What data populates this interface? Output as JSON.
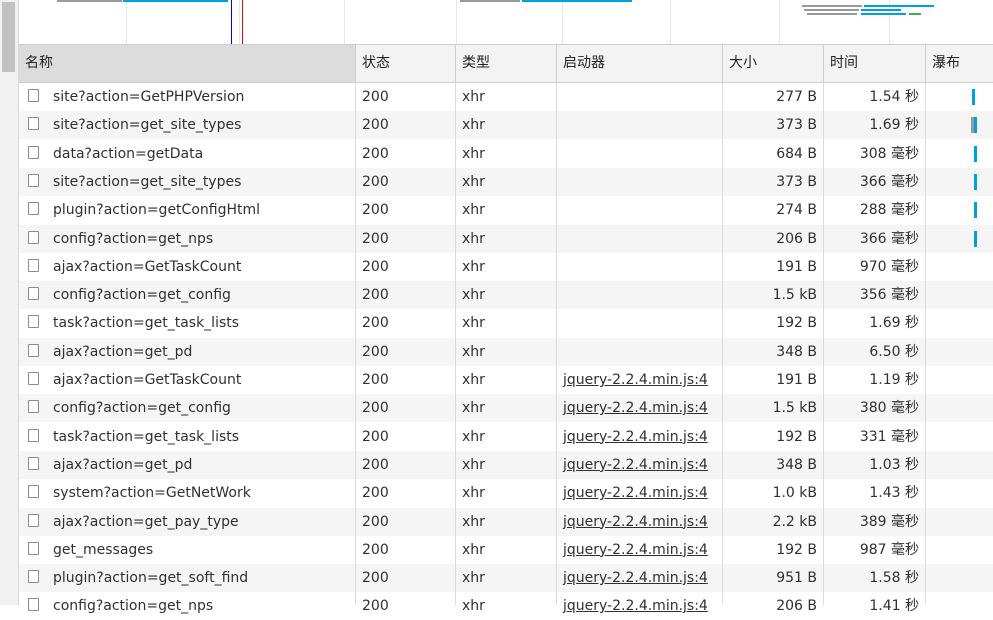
{
  "columns": {
    "name": "名称",
    "status": "状态",
    "type": "类型",
    "initiator": "启动器",
    "size": "大小",
    "time": "时间",
    "waterfall": "瀑布"
  },
  "rows": [
    {
      "name": "site?action=GetPHPVersion",
      "status": "200",
      "type": "xhr",
      "initiator": "",
      "size": "277 B",
      "time": "1.54 秒"
    },
    {
      "name": "site?action=get_site_types",
      "status": "200",
      "type": "xhr",
      "initiator": "",
      "size": "373 B",
      "time": "1.69 秒"
    },
    {
      "name": "data?action=getData",
      "status": "200",
      "type": "xhr",
      "initiator": "",
      "size": "684 B",
      "time": "308 毫秒"
    },
    {
      "name": "site?action=get_site_types",
      "status": "200",
      "type": "xhr",
      "initiator": "",
      "size": "373 B",
      "time": "366 毫秒"
    },
    {
      "name": "plugin?action=getConfigHtml",
      "status": "200",
      "type": "xhr",
      "initiator": "",
      "size": "274 B",
      "time": "288 毫秒"
    },
    {
      "name": "config?action=get_nps",
      "status": "200",
      "type": "xhr",
      "initiator": "",
      "size": "206 B",
      "time": "366 毫秒"
    },
    {
      "name": "ajax?action=GetTaskCount",
      "status": "200",
      "type": "xhr",
      "initiator": "",
      "size": "191 B",
      "time": "970 毫秒"
    },
    {
      "name": "config?action=get_config",
      "status": "200",
      "type": "xhr",
      "initiator": "",
      "size": "1.5 kB",
      "time": "356 毫秒"
    },
    {
      "name": "task?action=get_task_lists",
      "status": "200",
      "type": "xhr",
      "initiator": "",
      "size": "192 B",
      "time": "1.69 秒"
    },
    {
      "name": "ajax?action=get_pd",
      "status": "200",
      "type": "xhr",
      "initiator": "",
      "size": "348 B",
      "time": "6.50 秒"
    },
    {
      "name": "ajax?action=GetTaskCount",
      "status": "200",
      "type": "xhr",
      "initiator": "jquery-2.2.4.min.js:4",
      "size": "191 B",
      "time": "1.19 秒"
    },
    {
      "name": "config?action=get_config",
      "status": "200",
      "type": "xhr",
      "initiator": "jquery-2.2.4.min.js:4",
      "size": "1.5 kB",
      "time": "380 毫秒"
    },
    {
      "name": "task?action=get_task_lists",
      "status": "200",
      "type": "xhr",
      "initiator": "jquery-2.2.4.min.js:4",
      "size": "192 B",
      "time": "331 毫秒"
    },
    {
      "name": "ajax?action=get_pd",
      "status": "200",
      "type": "xhr",
      "initiator": "jquery-2.2.4.min.js:4",
      "size": "348 B",
      "time": "1.03 秒"
    },
    {
      "name": "system?action=GetNetWork",
      "status": "200",
      "type": "xhr",
      "initiator": "jquery-2.2.4.min.js:4",
      "size": "1.0 kB",
      "time": "1.43 秒"
    },
    {
      "name": "ajax?action=get_pay_type",
      "status": "200",
      "type": "xhr",
      "initiator": "jquery-2.2.4.min.js:4",
      "size": "2.2 kB",
      "time": "389 毫秒"
    },
    {
      "name": "get_messages",
      "status": "200",
      "type": "xhr",
      "initiator": "jquery-2.2.4.min.js:4",
      "size": "192 B",
      "time": "987 毫秒"
    },
    {
      "name": "plugin?action=get_soft_find",
      "status": "200",
      "type": "xhr",
      "initiator": "jquery-2.2.4.min.js:4",
      "size": "951 B",
      "time": "1.58 秒"
    },
    {
      "name": "config?action=get_nps",
      "status": "200",
      "type": "xhr",
      "initiator": "jquery-2.2.4.min.js:4",
      "size": "206 B",
      "time": "1.41 秒"
    }
  ],
  "colors": {
    "accent": "#00a0dc",
    "dom_content_loaded_line": "#0000ff",
    "load_line": "#ff0000"
  }
}
